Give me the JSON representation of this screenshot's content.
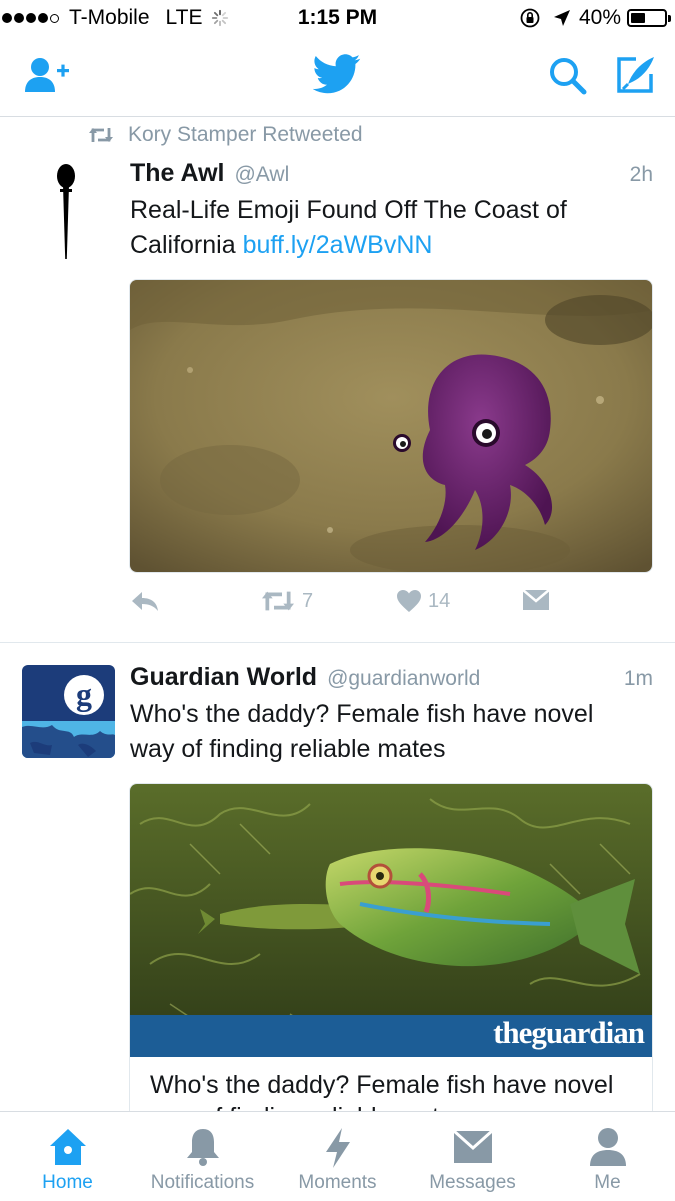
{
  "status_bar": {
    "carrier": "T-Mobile",
    "network": "LTE",
    "time": "1:15 PM",
    "battery_percent": "40%",
    "battery_level": 0.4
  },
  "nav": {
    "add_user_icon": "add-user-icon",
    "logo_icon": "twitter-bird-icon",
    "search_icon": "search-icon",
    "compose_icon": "compose-icon",
    "accent_color": "#1da1f2"
  },
  "tweets": [
    {
      "retweeted_by": "Kory Stamper Retweeted",
      "name": "The Awl",
      "handle": "@Awl",
      "time": "2h",
      "text": "Real-Life Emoji Found Off The Coast of California",
      "link": "buff.ly/2aWBvNN",
      "actions": {
        "retweets": "7",
        "likes": "14"
      }
    },
    {
      "name": "Guardian World",
      "handle": "@guardianworld",
      "time": "1m",
      "text": "Who's the daddy? Female fish have novel way of finding reliable mates",
      "card_brand": "theguardian",
      "card_title": "Who's the daddy? Female fish have novel way of finding reliable mates"
    }
  ],
  "tabs": [
    {
      "label": "Home",
      "icon": "home-icon",
      "active": true
    },
    {
      "label": "Notifications",
      "icon": "bell-icon",
      "active": false
    },
    {
      "label": "Moments",
      "icon": "lightning-icon",
      "active": false
    },
    {
      "label": "Messages",
      "icon": "envelope-icon",
      "active": false
    },
    {
      "label": "Me",
      "icon": "person-icon",
      "active": false
    }
  ]
}
